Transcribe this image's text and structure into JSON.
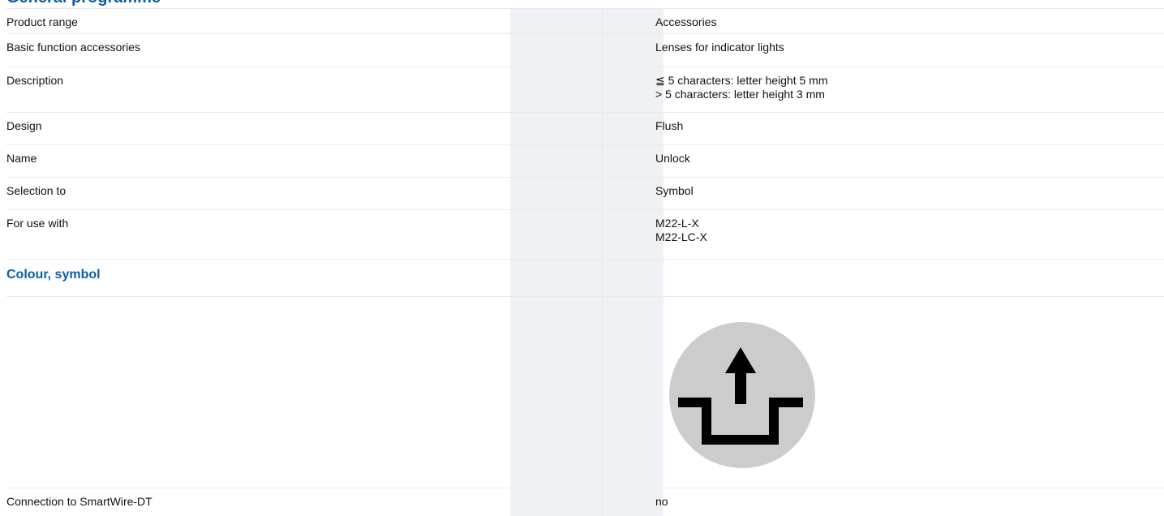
{
  "header": {
    "partial_heading": "General programme"
  },
  "rows": [
    {
      "label": "Product range",
      "value_lines": [
        "Accessories"
      ]
    },
    {
      "label": "Basic function accessories",
      "value_lines": [
        "Lenses for indicator lights"
      ]
    },
    {
      "label": "Description",
      "value_lines": [
        "≦ 5 characters: letter height 5 mm",
        "> 5 characters: letter height 3 mm"
      ]
    },
    {
      "label": "Design",
      "value_lines": [
        "Flush"
      ]
    },
    {
      "label": "Name",
      "value_lines": [
        "Unlock"
      ]
    },
    {
      "label": "Selection to",
      "value_lines": [
        "Symbol"
      ]
    },
    {
      "label": "For use with",
      "value_lines": [
        "M22-L-X",
        "M22-LC-X"
      ]
    }
  ],
  "section": {
    "title": "Colour, symbol"
  },
  "symbol": {
    "icon": "unlock-arrow-icon",
    "circle_color": "#cccccc",
    "glyph_color": "#000000"
  },
  "last_row": {
    "label": "Connection to SmartWire-DT",
    "value": "no"
  },
  "colors": {
    "heading_blue": "#0a5fa8",
    "shade_column": "#eff1f5",
    "row_border": "#e8eaee"
  }
}
